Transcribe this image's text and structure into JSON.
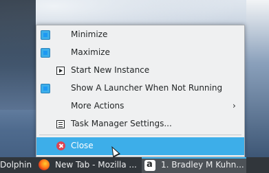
{
  "menu": {
    "items": [
      {
        "label": "Minimize",
        "checked": true
      },
      {
        "label": "Maximize",
        "checked": true
      },
      {
        "label": "Start New Instance",
        "icon": "play-icon"
      },
      {
        "label": "Show A Launcher When Not Running",
        "checked": true
      },
      {
        "label": "More Actions",
        "submenu": true
      },
      {
        "label": "Task Manager Settings...",
        "icon": "task-manager-icon"
      },
      {
        "label": "Close",
        "icon": "close-icon",
        "highlighted": true
      }
    ],
    "submenu_arrow": "›"
  },
  "taskbar": {
    "tasks": [
      {
        "label": "Dolphin"
      },
      {
        "label": "New Tab - Mozilla ...",
        "icon": "firefox-icon"
      },
      {
        "label": "1. Bradley M Kuhn...",
        "icon": "amazon-icon",
        "active": true
      }
    ]
  },
  "colors": {
    "accent": "#3daee9",
    "menu_bg": "#eff0f1",
    "taskbar_bg": "#31363b",
    "close_red": "#da4453"
  }
}
